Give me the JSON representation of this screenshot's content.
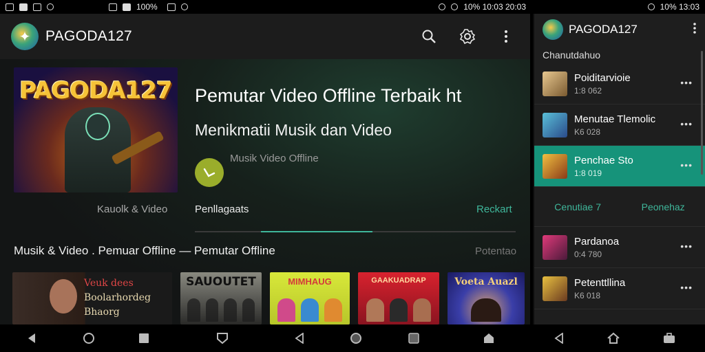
{
  "status_main": {
    "battery": "100%",
    "right": "10%  10:03 20:03"
  },
  "status_side": {
    "right": "10%  13:03"
  },
  "app": {
    "title": "PAGODA127"
  },
  "hero": {
    "poster_title": "PAGODA127",
    "headline": "Pemutar Video Offline Terbaik ht",
    "subhead": "Menikmatii Musik dan Video",
    "play_caption": "Musik Video Offline",
    "cap_left": "Kauolk & Video",
    "cap_mid": "Penllagaats",
    "cap_right": "Reckart",
    "progress": 0.35
  },
  "row": {
    "title": "Musik & Video . Pemuar Offline  —  Pemutar Offline",
    "more": "Potentao"
  },
  "thumbs": [
    {
      "lines": [
        "Veuk dees",
        "Boolarhordeg",
        "Bhaorg"
      ]
    },
    {
      "title": "SAUOUTET"
    },
    {
      "title": "MIMHAUG"
    },
    {
      "title": "GAAKUADRAP"
    },
    {
      "title": "Voeta Auazl"
    }
  ],
  "side": {
    "title": "PAGODA127",
    "section": "Chanutdahuo",
    "items": [
      {
        "name": "Poiditarvioie",
        "sub": "1:8 062",
        "color": "#c9a56a",
        "active": false
      },
      {
        "name": "Menutae Tlemolic",
        "sub": "K6 028",
        "color": "#3c8fa8",
        "active": false
      },
      {
        "name": "Penchae Sto",
        "sub": "1:8 019",
        "color": "#d8a030",
        "active": true
      }
    ],
    "tabs": [
      "Cenutiae 7",
      "Peonehaz"
    ],
    "items2": [
      {
        "name": "Pardanoa",
        "sub": "0:4 780",
        "color": "#c03a6a"
      },
      {
        "name": "Petenttllina",
        "sub": "K6 018",
        "color": "#d8b040"
      }
    ]
  },
  "colors": {
    "accent": "#3fb79b",
    "active_row": "#16937a"
  }
}
